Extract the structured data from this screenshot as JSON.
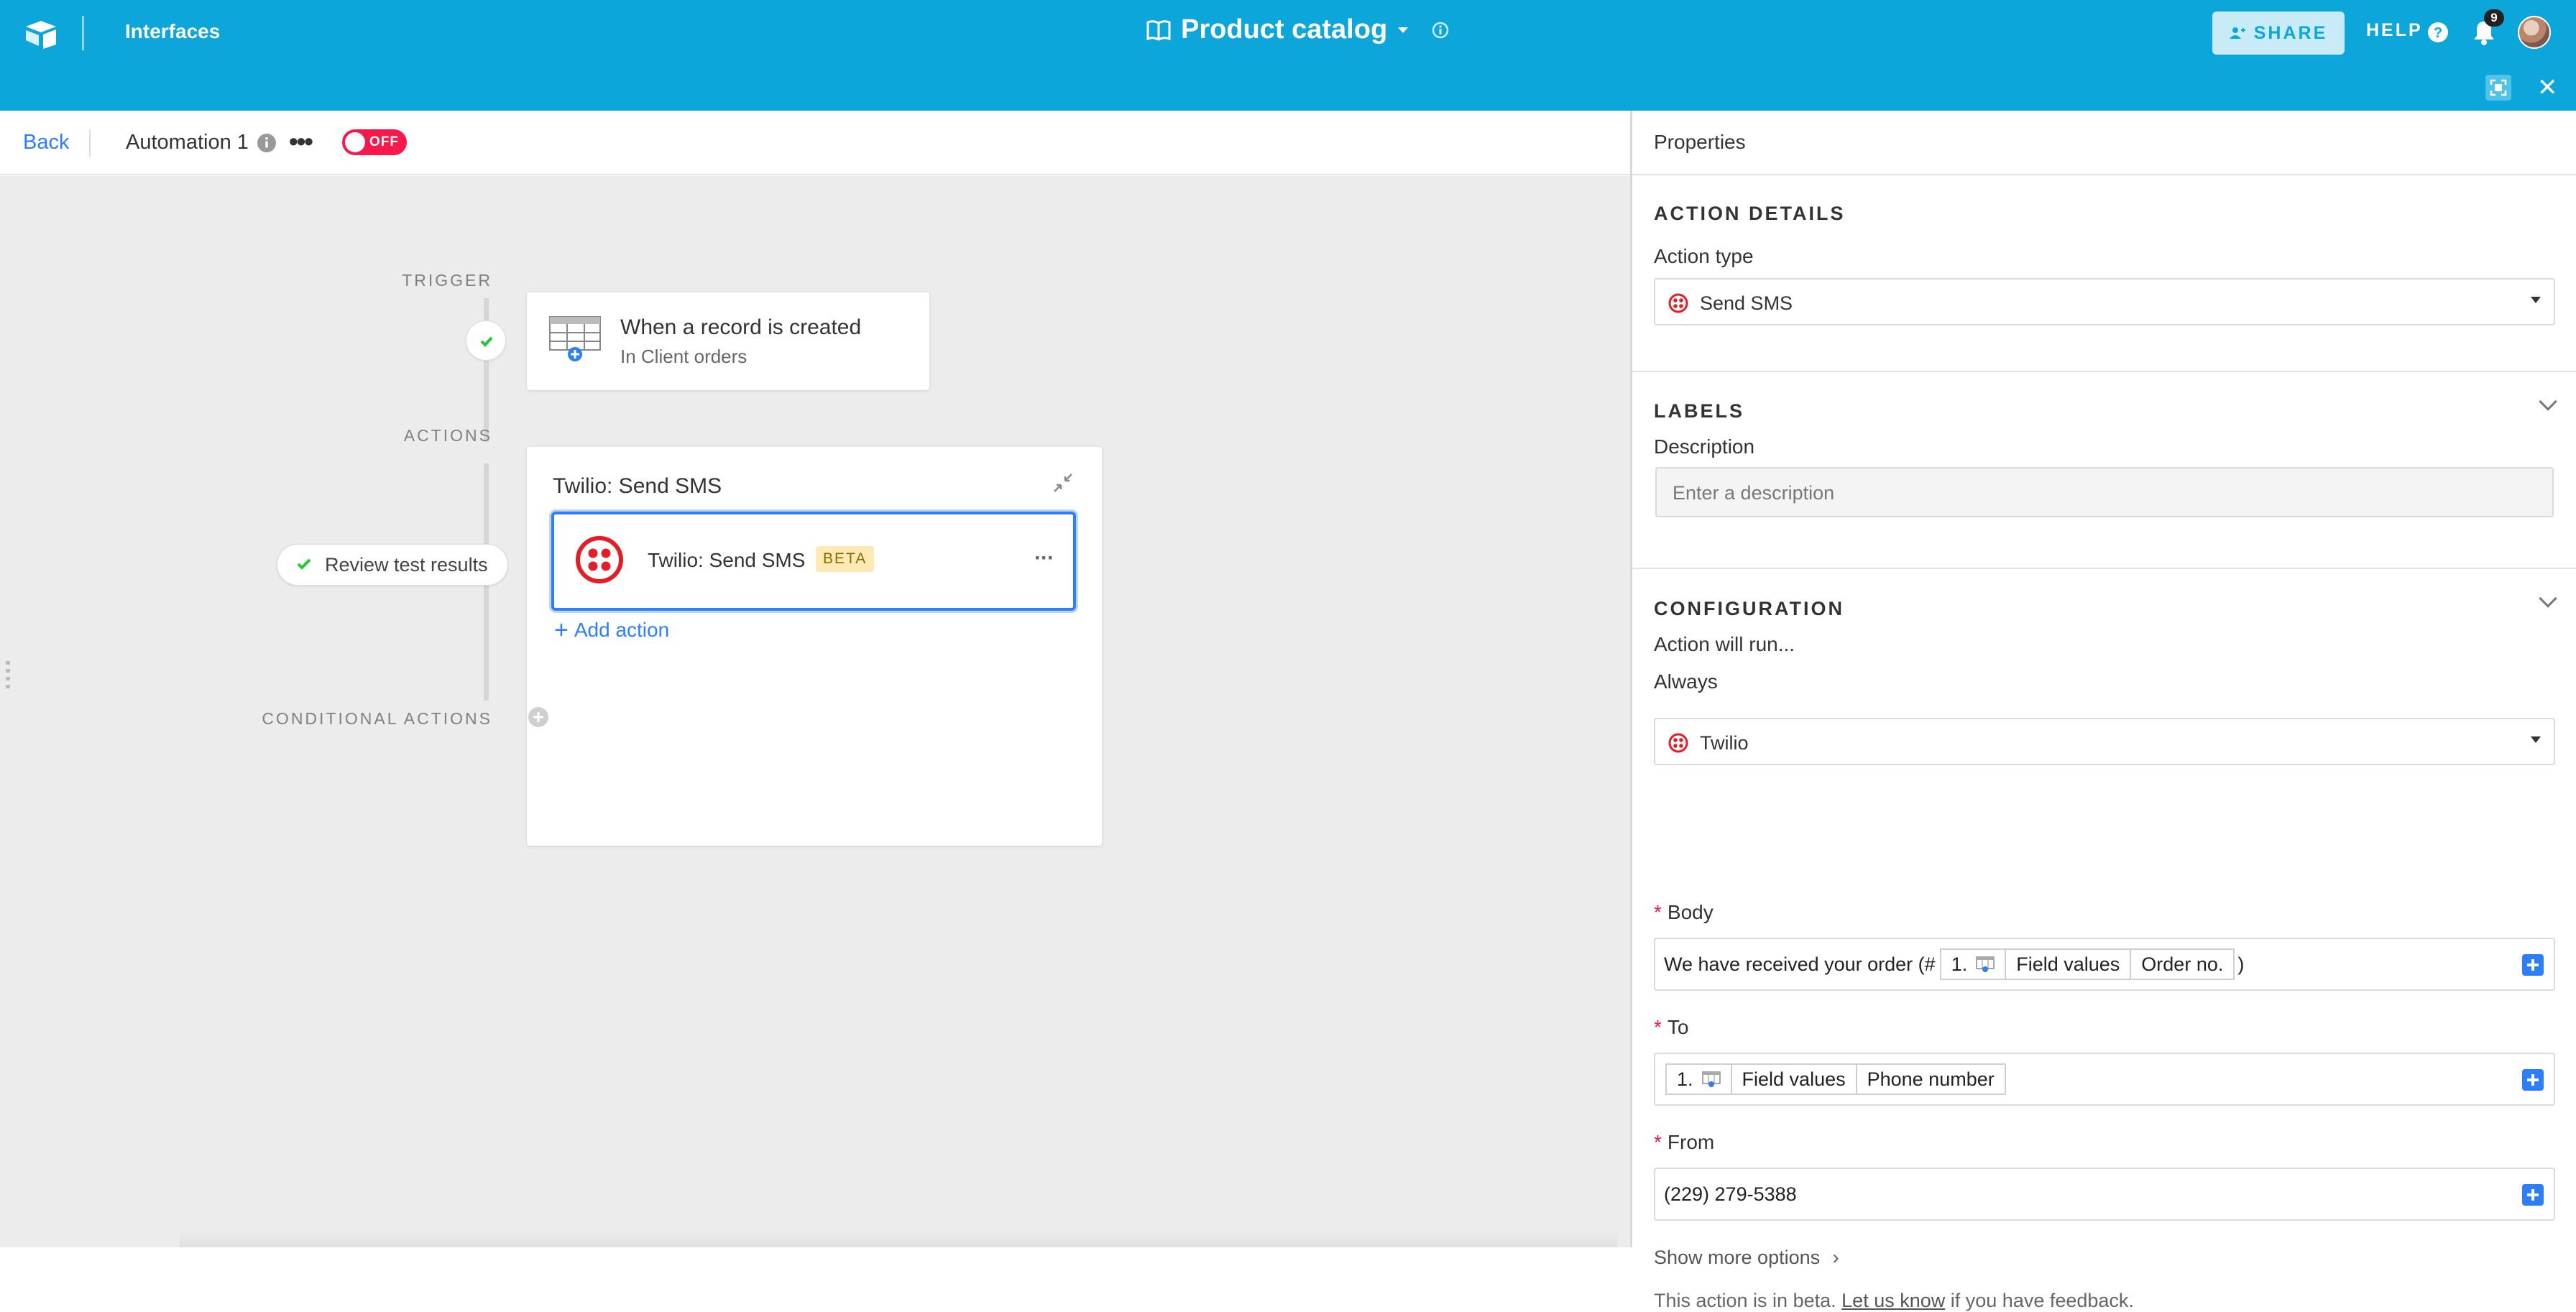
{
  "topbar": {
    "interfaces_label": "Interfaces",
    "base_title": "Product catalog",
    "share_label": "SHARE",
    "help_label": "HELP",
    "notification_count": "9"
  },
  "automation_header": {
    "back_label": "Back",
    "name": "Automation 1",
    "toggle_label": "OFF"
  },
  "canvas": {
    "trigger_label": "TRIGGER",
    "actions_label": "ACTIONS",
    "conditional_label": "CONDITIONAL ACTIONS",
    "trigger": {
      "title": "When a record is created",
      "subtitle": "In Client orders"
    },
    "actions_card_title": "Twilio: Send SMS",
    "action_item": {
      "label": "Twilio: Send SMS",
      "badge": "BETA"
    },
    "add_action_label": "Add action",
    "review_button": "Review test results"
  },
  "panel": {
    "header": "Properties",
    "action_details": {
      "title": "ACTION DETAILS",
      "type_label": "Action type",
      "type_value": "Send SMS"
    },
    "labels": {
      "title": "LABELS",
      "description_label": "Description",
      "description_placeholder": "Enter a description"
    },
    "configuration": {
      "title": "CONFIGURATION",
      "run_label": "Action will run...",
      "run_value": "Always",
      "account_value": "Twilio",
      "body_label": "Body",
      "body_prefix": "We have received your order (#",
      "body_tokens": [
        "1.",
        "Field values",
        "Order no."
      ],
      "body_suffix": ")",
      "to_label": "To",
      "to_tokens": [
        "1.",
        "Field values",
        "Phone number"
      ],
      "from_label": "From",
      "from_value": "(229) 279-5388",
      "show_more": "Show more options",
      "beta_note_prefix": "This action is in beta.",
      "beta_note_link": "Let us know",
      "beta_note_suffix": "if you have feedback."
    }
  },
  "colors": {
    "topbar": "#0ca6db",
    "link_blue": "#2d7ff9",
    "toggle_off": "#f8184b",
    "twilio_red": "#e31e26"
  }
}
